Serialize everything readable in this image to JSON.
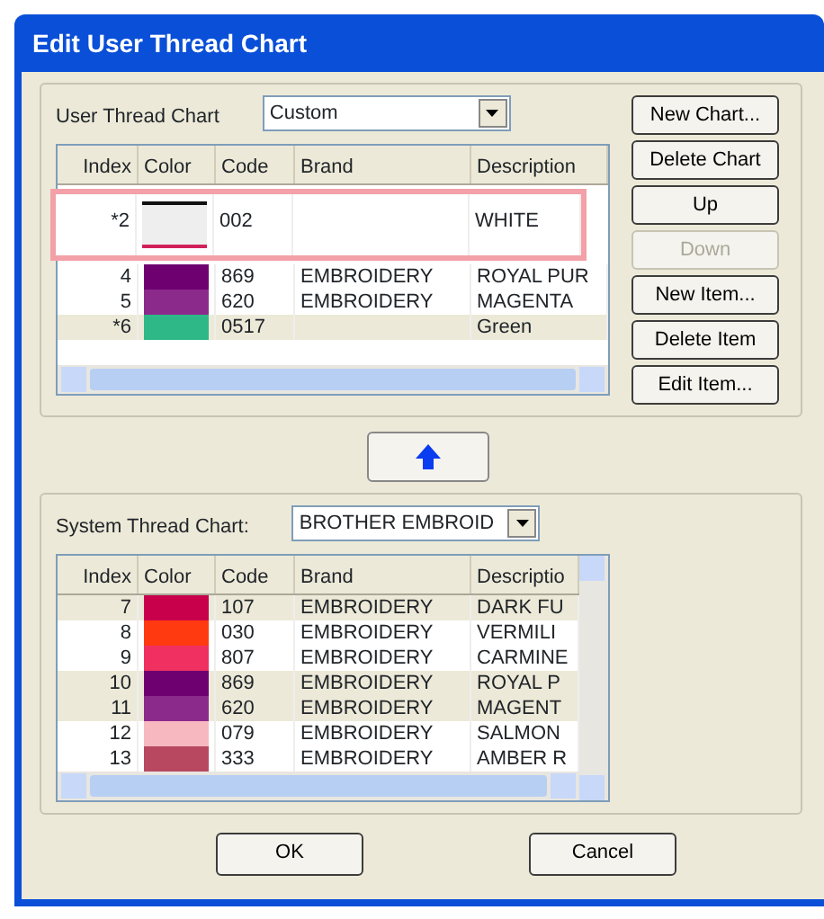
{
  "window": {
    "title": "Edit User Thread Chart"
  },
  "user_chart": {
    "label": "User Thread Chart",
    "value": "Custom",
    "columns": [
      "Index",
      "Color",
      "Code",
      "Brand",
      "Description"
    ],
    "rows": [
      {
        "index": "*2",
        "color": "#eeeeee",
        "code": "002",
        "brand": "",
        "description": "WHITE",
        "selected": false,
        "highlighted": true
      },
      {
        "index": "4",
        "color": "#6e0070",
        "code": "869",
        "brand": "EMBROIDERY",
        "description": "ROYAL PUR",
        "selected": false,
        "highlighted": false
      },
      {
        "index": "5",
        "color": "#8c2a8c",
        "code": "620",
        "brand": "EMBROIDERY",
        "description": "MAGENTA",
        "selected": false,
        "highlighted": false
      },
      {
        "index": "*6",
        "color": "#2eb888",
        "code": "0517",
        "brand": "",
        "description": "Green",
        "selected": true,
        "highlighted": false
      }
    ]
  },
  "side_buttons": [
    {
      "label": "New Chart...",
      "disabled": false
    },
    {
      "label": "Delete Chart",
      "disabled": false
    },
    {
      "label": "Up",
      "disabled": false
    },
    {
      "label": "Down",
      "disabled": true
    },
    {
      "label": "New Item...",
      "disabled": false
    },
    {
      "label": "Delete Item",
      "disabled": false
    },
    {
      "label": "Edit Item...",
      "disabled": false
    }
  ],
  "system_chart": {
    "label": "System Thread Chart:",
    "value": "BROTHER EMBROID",
    "columns": [
      "Index",
      "Color",
      "Code",
      "Brand",
      "Descriptio"
    ],
    "rows": [
      {
        "index": "7",
        "color": "#c8004c",
        "code": "107",
        "brand": "EMBROIDERY",
        "description": "DARK FU",
        "selected": true
      },
      {
        "index": "8",
        "color": "#ff3a10",
        "code": "030",
        "brand": "EMBROIDERY",
        "description": "VERMILI",
        "selected": false
      },
      {
        "index": "9",
        "color": "#f03060",
        "code": "807",
        "brand": "EMBROIDERY",
        "description": "CARMINE",
        "selected": false
      },
      {
        "index": "10",
        "color": "#6e0070",
        "code": "869",
        "brand": "EMBROIDERY",
        "description": "ROYAL P",
        "selected": true
      },
      {
        "index": "11",
        "color": "#8c2a8c",
        "code": "620",
        "brand": "EMBROIDERY",
        "description": "MAGENT",
        "selected": true
      },
      {
        "index": "12",
        "color": "#f8b8c0",
        "code": "079",
        "brand": "EMBROIDERY",
        "description": "SALMON",
        "selected": false
      },
      {
        "index": "13",
        "color": "#b84860",
        "code": "333",
        "brand": "EMBROIDERY",
        "description": "AMBER R",
        "selected": false
      }
    ]
  },
  "dialog_buttons": [
    "OK",
    "Cancel"
  ]
}
